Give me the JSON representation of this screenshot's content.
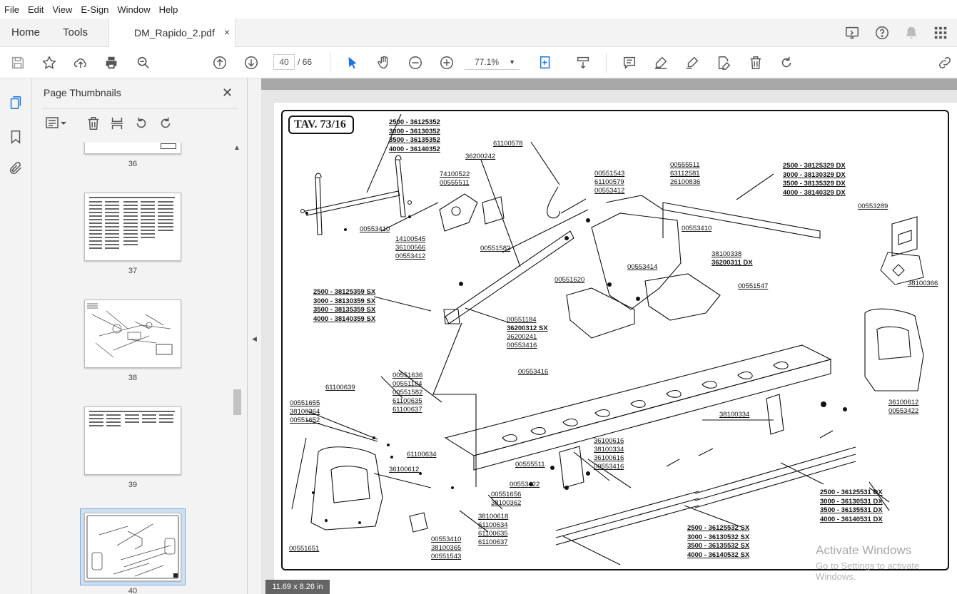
{
  "menu": [
    "File",
    "Edit",
    "View",
    "E-Sign",
    "Window",
    "Help"
  ],
  "tabs": {
    "home": "Home",
    "tools": "Tools",
    "document": "DM_Rapido_2.pdf",
    "close": "×"
  },
  "toolbar": {
    "page_current": "40",
    "page_total": "/  66",
    "zoom": "77.1%"
  },
  "panel": {
    "title": "Page Thumbnails",
    "close": "✕"
  },
  "thumbnails": [
    {
      "label": "36"
    },
    {
      "label": "37"
    },
    {
      "label": "38"
    },
    {
      "label": "39"
    },
    {
      "label": "40"
    }
  ],
  "drawing": {
    "title": "TAV. 73/16",
    "block_top": [
      "2500 - 36125352",
      "3000 - 36130352",
      "3500 - 36135352",
      "4000 - 36140352"
    ],
    "block_dx_top": [
      "2500 - 38125329 DX",
      "3000 - 38130329 DX",
      "3500 - 38135329 DX",
      "4000 - 38140329 DX"
    ],
    "block_sx_mid": [
      "2500 - 38125359 SX",
      "3000 - 38130359 SX",
      "3500 - 38135359 SX",
      "4000 - 38140359 SX"
    ],
    "block_dx_bottom": [
      "2500 - 36125531 DX",
      "3000 - 36130531 DX",
      "3500 - 36135531 DX",
      "4000 - 36140531 DX"
    ],
    "block_sx_bottom": [
      "2500 - 36125532 SX",
      "3000 - 36130532 SX",
      "3500 - 36135532 SX",
      "4000 - 36140532 SX"
    ],
    "parts": {
      "p61100578": "61100578",
      "p36200242": "36200242",
      "p74100522": "74100522",
      "p00555511a": "00555511",
      "p00551543": "00551543",
      "p61100579": "61100579",
      "p00553412a": "00553412",
      "p00555511b": "00555511",
      "p63112581": "63112581",
      "p26100836": "26100836",
      "p00553410a": "00553410",
      "p14100545": "14100545",
      "p36100566": "36100566",
      "p00553412b": "00553412",
      "p00551582a": "00551582",
      "p00553410b": "00553410",
      "p00553289": "00553289",
      "p38100338": "38100338",
      "p36200311": "36200311 DX",
      "p00553414": "00553414",
      "p00551620": "00551620",
      "p00551547": "00551547",
      "p38100366": "38100366",
      "p00551184a": "00551184",
      "p36200312": "36200312 SX",
      "p36200241": "36200241",
      "p00553416a": "00553416",
      "p00551636": "00551636",
      "p00551184b": "00551184",
      "p00551582b": "00551582",
      "p61100635a": "61100635",
      "p61100637a": "61100637",
      "p61100639": "61100639",
      "p00553416b": "00553416",
      "p00551655": "00551655",
      "p38100364": "38100364",
      "p00551652": "00551652",
      "p61100634a": "61100634",
      "p36100612a": "36100612",
      "p00555511c": "00555511",
      "p00553422a": "00553422",
      "p00551656": "00551656",
      "p38100362": "38100362",
      "p36100616a": "36100616",
      "p38100334a": "38100334",
      "p36100616b": "36100616",
      "p00553416c": "00553416",
      "p38100334b": "38100334",
      "p36100612b": "36100612",
      "p00553422b": "00553422",
      "p38100618": "38100618",
      "p61100634b": "61100634",
      "p61100635b": "61100635",
      "p61100637b": "61100637",
      "p00553410c": "00553410",
      "p38100365": "38100365",
      "p00551543b": "00551543",
      "p00551651": "00551651"
    }
  },
  "status": {
    "dimensions": "11.69 x 8.26 in"
  },
  "watermark": {
    "line1": "Activate Windows",
    "line2": "Go to Settings to activate Windows."
  }
}
